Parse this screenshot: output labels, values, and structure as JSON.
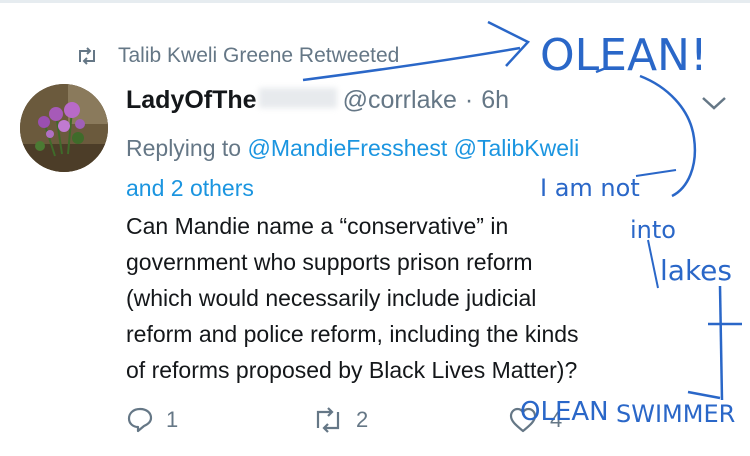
{
  "retweet_banner": {
    "text": "Talib Kweli Greene Retweeted",
    "icon": "retweet-icon"
  },
  "tweet": {
    "author_name": "LadyOfThe",
    "author_handle": "@corrlake",
    "separator": "·",
    "timestamp": "6h",
    "replying_prefix": "Replying to ",
    "mention_1": "@MandieFresshest",
    "mention_2": "@TalibKweli",
    "and_others": "and 2 others",
    "body_lines": [
      "Can Mandie name a “conservative” in",
      "government who supports prison reform",
      "(which would necessarily include judicial",
      "reform and police reform, including the kinds",
      "of reforms proposed by Black Lives Matter)?"
    ]
  },
  "actions": {
    "reply_count": "1",
    "retweet_count": "2",
    "like_count": "4"
  },
  "annotations": {
    "olean": "OLEAN!",
    "i_am_not": "I am not",
    "into": "into",
    "lakes": "lakes",
    "olean_swimmer_1": "OLEAN",
    "olean_swimmer_2": "SWIMMER"
  },
  "colors": {
    "text": "#14171a",
    "secondary": "#657786",
    "link": "#1b95e0",
    "ink": "#2a67c8"
  }
}
